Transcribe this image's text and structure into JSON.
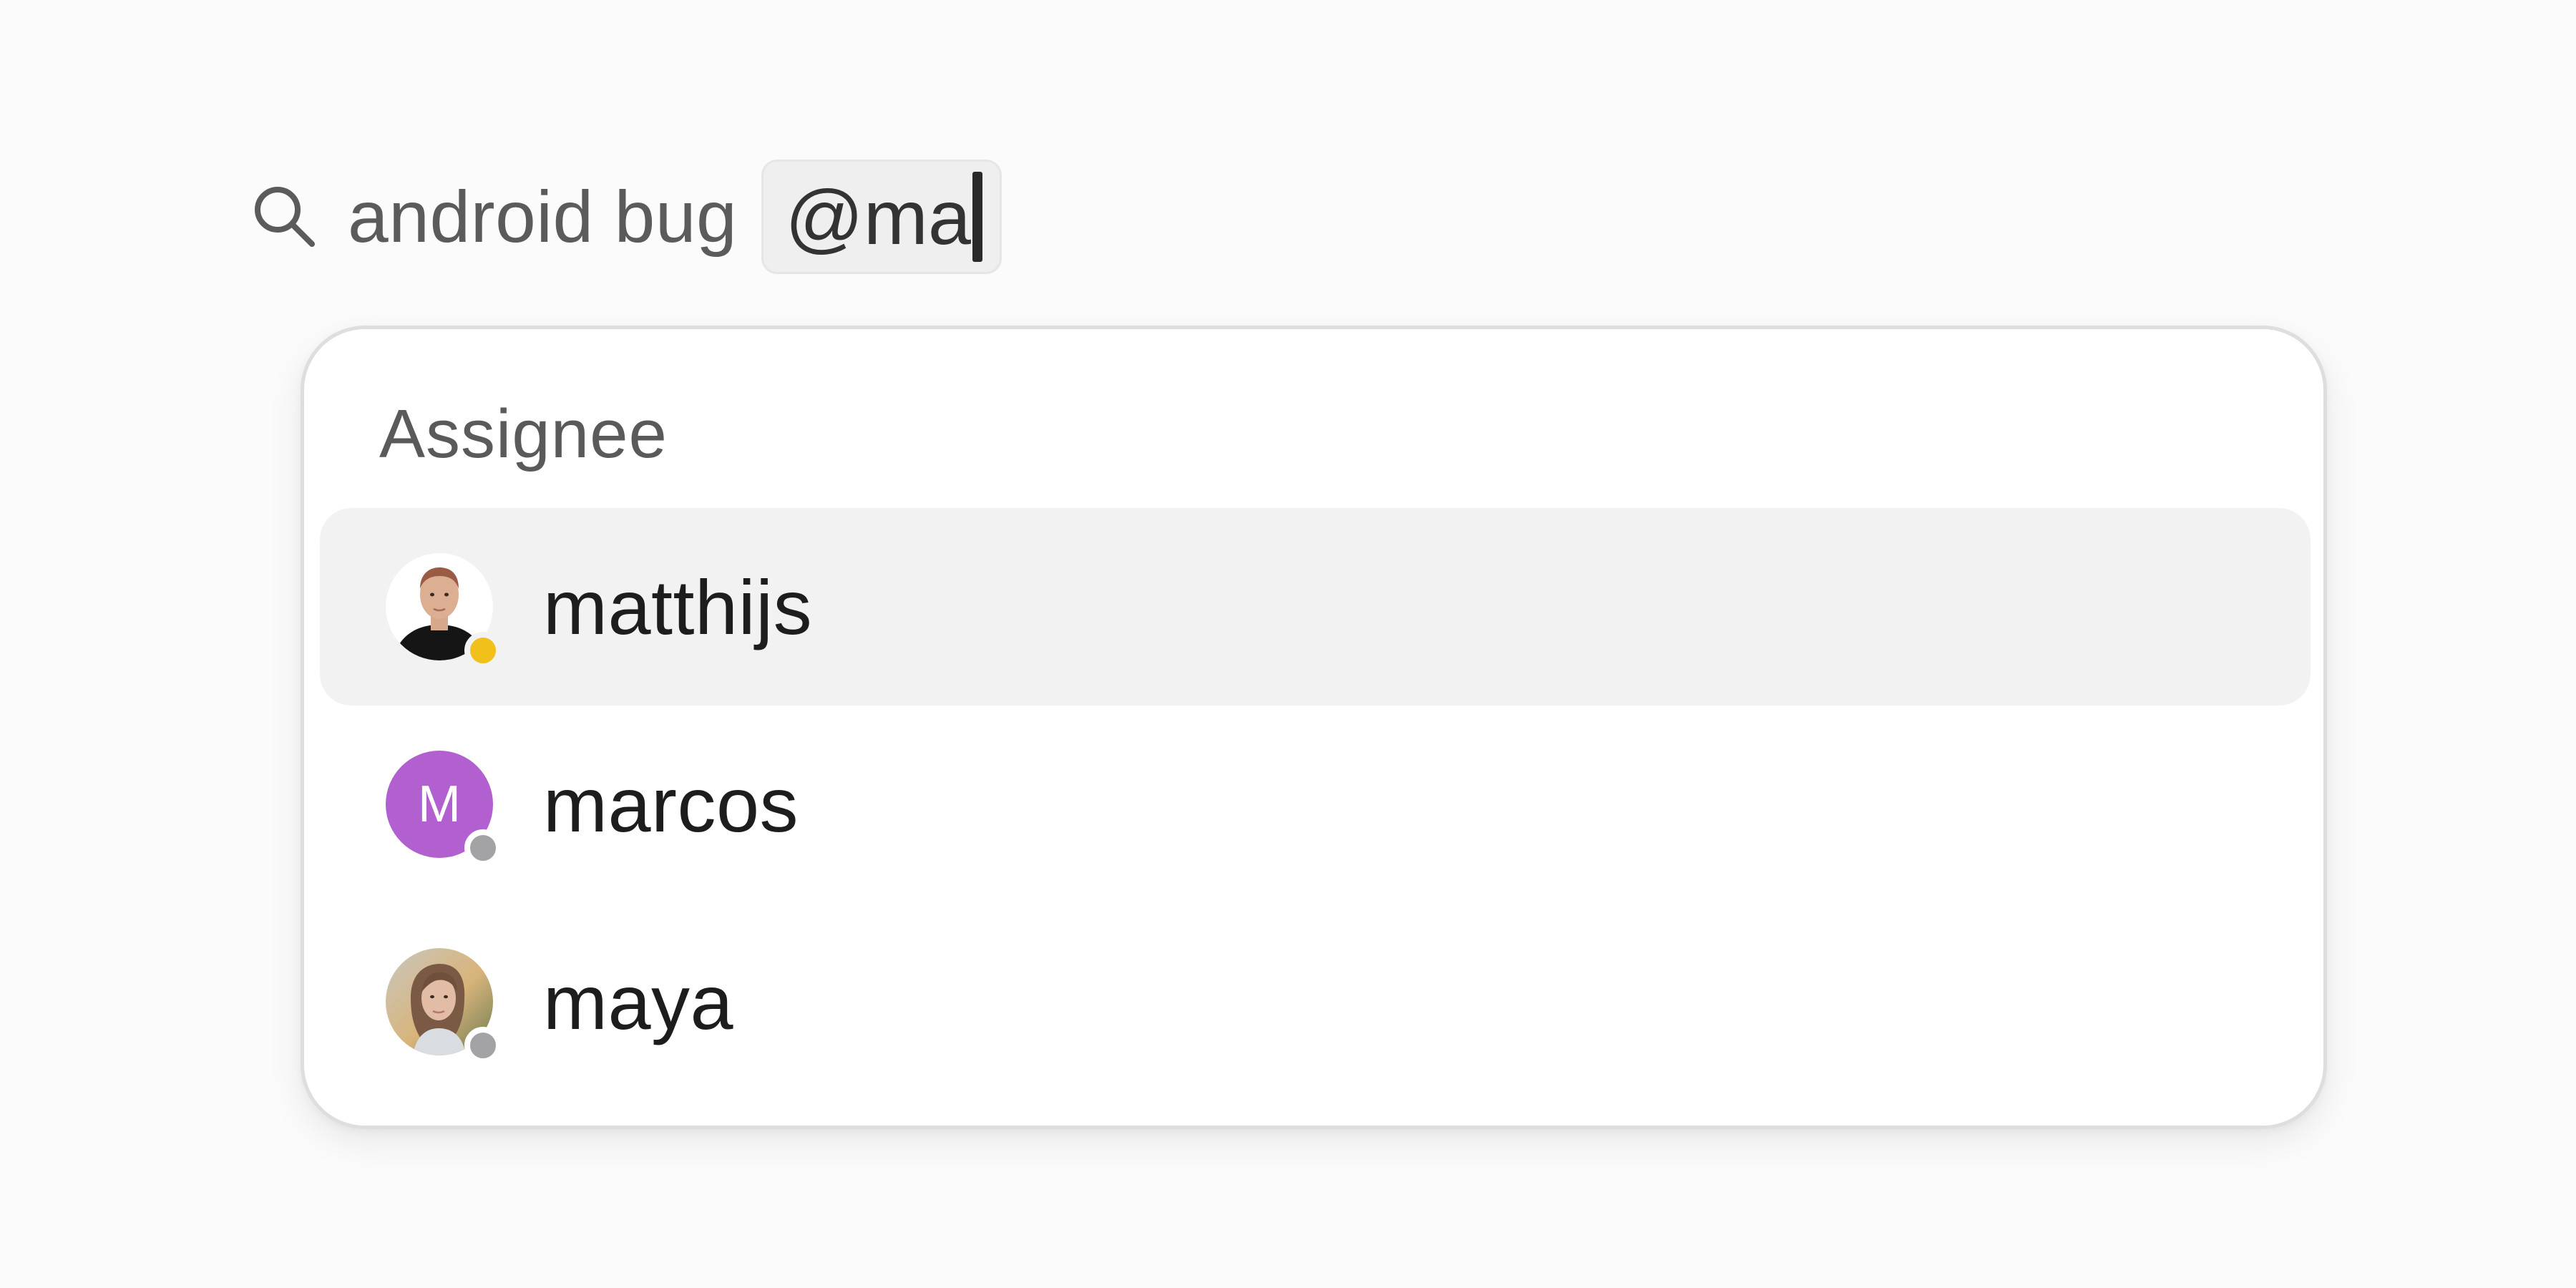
{
  "search": {
    "query": "android bug",
    "mention": "@ma"
  },
  "dropdown": {
    "header": "Assignee",
    "options": [
      {
        "label": "matthijs",
        "avatar": "photo-man",
        "status": "away",
        "status_color": "#f2c01a",
        "selected": true
      },
      {
        "label": "marcos",
        "avatar": "initial",
        "initial": "M",
        "avatar_color": "#b25fd0",
        "status": "offline",
        "status_color": "#a3a3a5",
        "selected": false
      },
      {
        "label": "maya",
        "avatar": "photo-woman",
        "status": "offline",
        "status_color": "#a3a3a5",
        "selected": false
      }
    ]
  }
}
